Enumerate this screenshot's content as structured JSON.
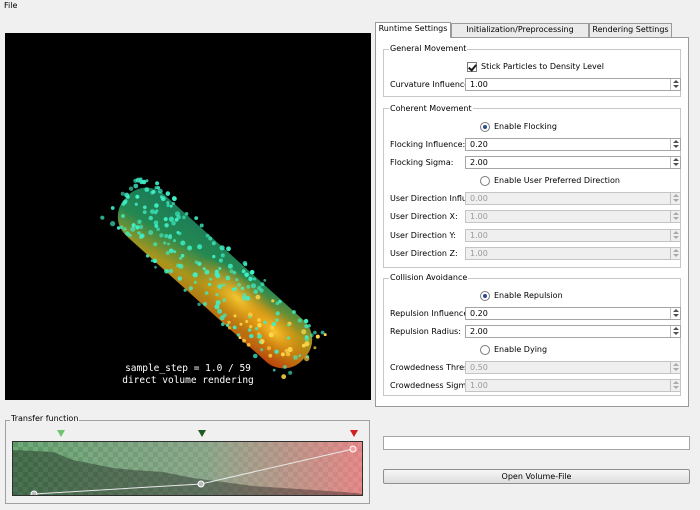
{
  "menubar": {
    "file": "File"
  },
  "viewport": {
    "line1": "sample_step = 1.0 / 59",
    "line2": "direct volume rendering"
  },
  "transfer_function": {
    "label": "Transfer function",
    "marker_colors": [
      "#6ec46e",
      "#1f5a1f",
      "#d02020"
    ],
    "gradient_start": "#1c7a2c",
    "gradient_end": "#d01818"
  },
  "tabs": {
    "runtime": "Runtime Settings",
    "init": "Initialization/Preprocessing Settings",
    "rendering": "Rendering Settings"
  },
  "general": {
    "title": "General Movement",
    "stick_label": "Stick Particles to Density Level",
    "stick_checked": true,
    "curvature_label": "Curvature Influence:",
    "curvature_value": "1.00"
  },
  "coherent": {
    "title": "Coherent Movement",
    "enable_flocking": "Enable Flocking",
    "flocking_influence_label": "Flocking Influence:",
    "flocking_influence_value": "0.20",
    "flocking_sigma_label": "Flocking Sigma:",
    "flocking_sigma_value": "2.00",
    "enable_user_dir": "Enable User Preferred Direction",
    "user_dir_influence_label": "User Direction Influence:",
    "user_dir_influence_value": "0.00",
    "user_dir_x_label": "User Direction X:",
    "user_dir_x_value": "1.00",
    "user_dir_y_label": "User Direction Y:",
    "user_dir_y_value": "1.00",
    "user_dir_z_label": "User Direction Z:",
    "user_dir_z_value": "1.00"
  },
  "collision": {
    "title": "Collision Avoidance",
    "enable_repulsion": "Enable Repulsion",
    "repulsion_influence_label": "Repulsion Influence:",
    "repulsion_influence_value": "0.20",
    "repulsion_radius_label": "Repulsion Radius:",
    "repulsion_radius_value": "2.00",
    "enable_dying": "Enable Dying",
    "crowd_threshold_label": "Crowdedness Threshold:",
    "crowd_threshold_value": "0.50",
    "crowd_sigma_label": "Crowdedness Sigma:",
    "crowd_sigma_value": "1.00"
  },
  "file_path": "",
  "open_button": "Open Volume-File"
}
